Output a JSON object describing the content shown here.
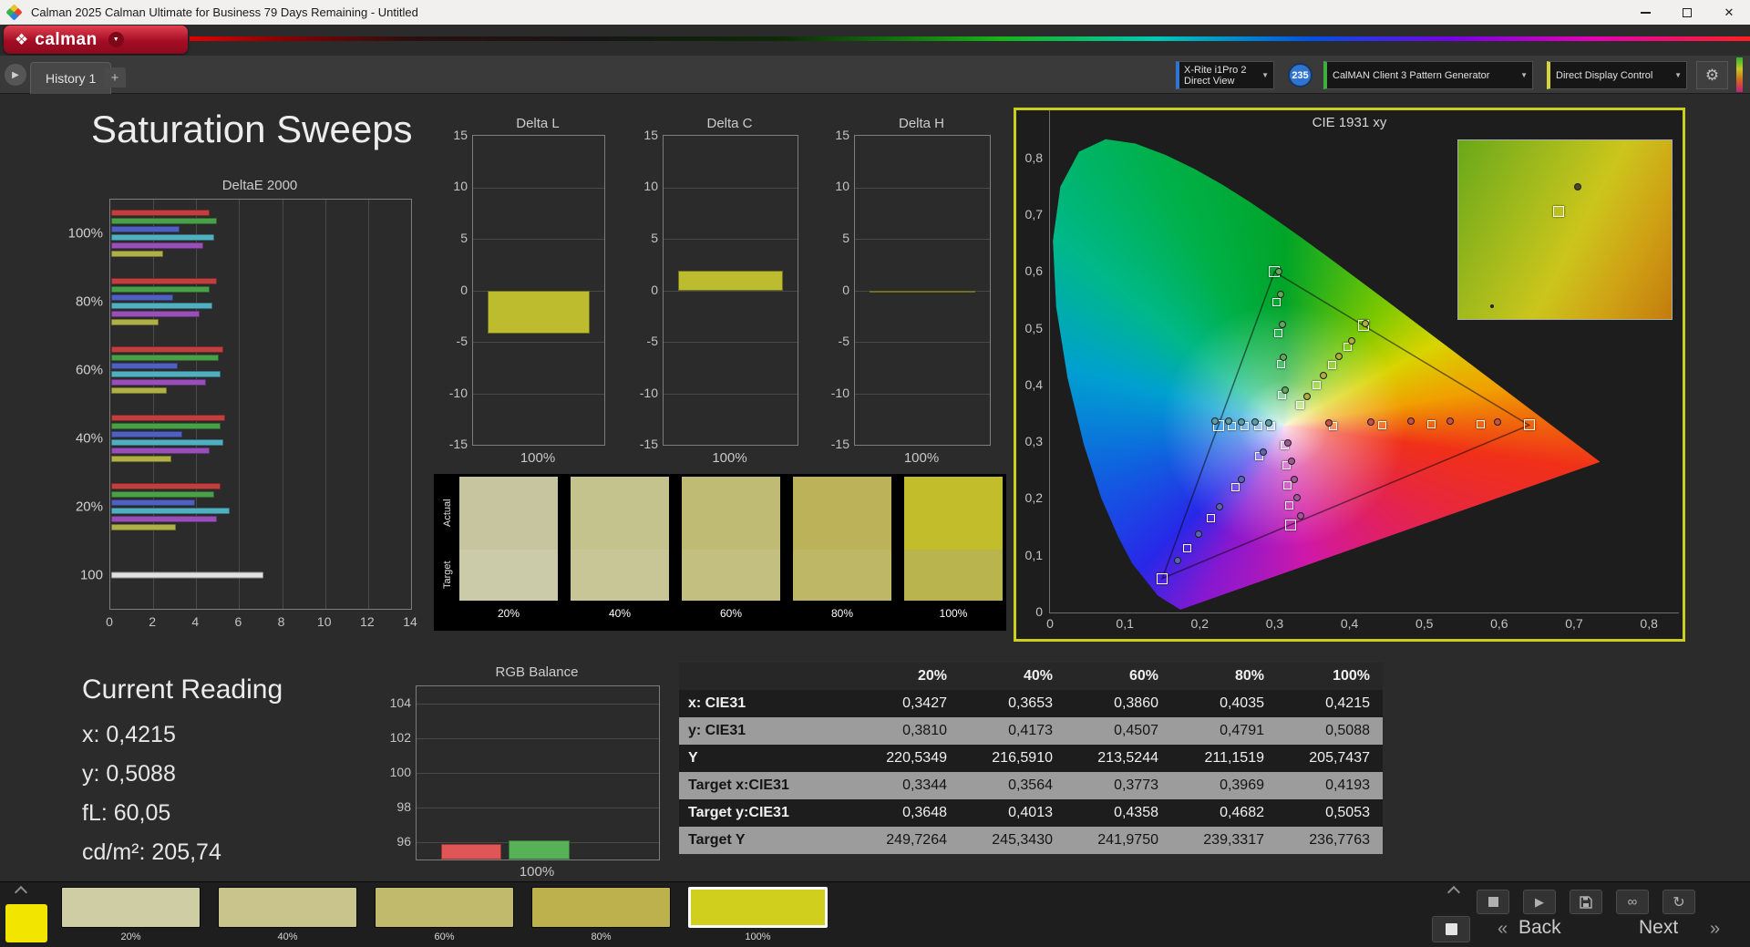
{
  "window": {
    "title": "Calman 2025 Calman Ultimate for Business 79 Days Remaining  - Untitled"
  },
  "brand": {
    "logo_text": "calman"
  },
  "tabs": {
    "history_label": "History 1",
    "add_label": "+"
  },
  "toolbar": {
    "meter_line1": "X-Rite i1Pro 2",
    "meter_line2": "Direct View",
    "badge": "235",
    "pattern_generator": "CalMAN Client 3 Pattern Generator",
    "display_control": "Direct Display Control"
  },
  "page": {
    "title": "Saturation Sweeps"
  },
  "current_reading": {
    "title": "Current Reading",
    "lines": [
      "x: 0,4215",
      "y: 0,5088",
      "fL: 60,05",
      "cd/m²: 205,74"
    ]
  },
  "swatch_panel": {
    "row_labels": [
      "Actual",
      "Target"
    ],
    "columns": [
      "20%",
      "40%",
      "60%",
      "80%",
      "100%"
    ],
    "actual_colors": [
      "#c6c5a0",
      "#c4c28d",
      "#bfba74",
      "#bbb25a",
      "#c2bd2a"
    ],
    "target_colors": [
      "#cbcaa9",
      "#c8c697",
      "#c3bf80",
      "#beb766",
      "#bab44e"
    ]
  },
  "table": {
    "columns": [
      "20%",
      "40%",
      "60%",
      "80%",
      "100%"
    ],
    "rows": [
      {
        "label": "x: CIE31",
        "shade": "dark",
        "values": [
          "0,3427",
          "0,3653",
          "0,3860",
          "0,4035",
          "0,4215"
        ]
      },
      {
        "label": "y: CIE31",
        "shade": "light",
        "values": [
          "0,3810",
          "0,4173",
          "0,4507",
          "0,4791",
          "0,5088"
        ]
      },
      {
        "label": "Y",
        "shade": "dark",
        "values": [
          "220,5349",
          "216,5910",
          "213,5244",
          "211,1519",
          "205,7437"
        ]
      },
      {
        "label": "Target x:CIE31",
        "shade": "light",
        "values": [
          "0,3344",
          "0,3564",
          "0,3773",
          "0,3969",
          "0,4193"
        ]
      },
      {
        "label": "Target y:CIE31",
        "shade": "dark",
        "values": [
          "0,3648",
          "0,4013",
          "0,4358",
          "0,4682",
          "0,5053"
        ]
      },
      {
        "label": "Target Y",
        "shade": "light",
        "values": [
          "249,7264",
          "245,3430",
          "241,9750",
          "239,3317",
          "236,7763"
        ]
      }
    ]
  },
  "bottom": {
    "preview_color": "#f2e500",
    "swatches": [
      {
        "label": "20%",
        "color": "#cfcda4",
        "selected": false
      },
      {
        "label": "40%",
        "color": "#c8c48c",
        "selected": false
      },
      {
        "label": "60%",
        "color": "#c1ba6c",
        "selected": false
      },
      {
        "label": "80%",
        "color": "#bcb14c",
        "selected": false
      },
      {
        "label": "100%",
        "color": "#d0cf1e",
        "selected": true
      }
    ],
    "back": "Back",
    "next": "Next",
    "back_arrow": "«",
    "next_arrow": "»"
  },
  "chart_data": [
    {
      "id": "deltae2000",
      "type": "bar",
      "orientation": "horizontal",
      "title": "DeltaE 2000",
      "xlim": [
        0,
        14
      ],
      "xticks": [
        0,
        2,
        4,
        6,
        8,
        10,
        12,
        14
      ],
      "palette": {
        "red": "#c04040",
        "green": "#49a049",
        "blue": "#5060c0",
        "cyan": "#50b0c0",
        "magenta": "#9850b8",
        "yellow": "#b0b048",
        "white": "#e2e2e2"
      },
      "groups": [
        {
          "label": "100%",
          "bars": [
            {
              "color": "red",
              "value": 4.6
            },
            {
              "color": "green",
              "value": 4.9
            },
            {
              "color": "blue",
              "value": 3.2
            },
            {
              "color": "cyan",
              "value": 4.8
            },
            {
              "color": "magenta",
              "value": 4.3
            },
            {
              "color": "yellow",
              "value": 2.4
            }
          ]
        },
        {
          "label": "80%",
          "bars": [
            {
              "color": "red",
              "value": 4.9
            },
            {
              "color": "green",
              "value": 4.6
            },
            {
              "color": "blue",
              "value": 2.9
            },
            {
              "color": "cyan",
              "value": 4.7
            },
            {
              "color": "magenta",
              "value": 4.1
            },
            {
              "color": "yellow",
              "value": 2.2
            }
          ]
        },
        {
          "label": "60%",
          "bars": [
            {
              "color": "red",
              "value": 5.2
            },
            {
              "color": "green",
              "value": 5.0
            },
            {
              "color": "blue",
              "value": 3.1
            },
            {
              "color": "cyan",
              "value": 5.1
            },
            {
              "color": "magenta",
              "value": 4.4
            },
            {
              "color": "yellow",
              "value": 2.6
            }
          ]
        },
        {
          "label": "40%",
          "bars": [
            {
              "color": "red",
              "value": 5.3
            },
            {
              "color": "green",
              "value": 5.1
            },
            {
              "color": "blue",
              "value": 3.3
            },
            {
              "color": "cyan",
              "value": 5.2
            },
            {
              "color": "magenta",
              "value": 4.6
            },
            {
              "color": "yellow",
              "value": 2.8
            }
          ]
        },
        {
          "label": "20%",
          "bars": [
            {
              "color": "red",
              "value": 5.1
            },
            {
              "color": "green",
              "value": 4.8
            },
            {
              "color": "blue",
              "value": 3.9
            },
            {
              "color": "cyan",
              "value": 5.5
            },
            {
              "color": "magenta",
              "value": 4.9
            },
            {
              "color": "yellow",
              "value": 3.0
            }
          ]
        },
        {
          "label": "100",
          "bars": [
            {
              "color": "white",
              "value": 7.1
            }
          ]
        }
      ]
    },
    {
      "id": "delta_l",
      "type": "bar",
      "title": "Delta L",
      "ylim": [
        -15,
        15
      ],
      "yticks": [
        15,
        10,
        5,
        0,
        -5,
        -10,
        -15
      ],
      "xlabel": "100%",
      "value": -4.2,
      "bar_color": "#bcbc2e"
    },
    {
      "id": "delta_c",
      "type": "bar",
      "title": "Delta C",
      "ylim": [
        -15,
        15
      ],
      "yticks": [
        15,
        10,
        5,
        0,
        -5,
        -10,
        -15
      ],
      "xlabel": "100%",
      "value": 1.9,
      "bar_color": "#bcbc2e"
    },
    {
      "id": "delta_h",
      "type": "bar",
      "title": "Delta H",
      "ylim": [
        -15,
        15
      ],
      "yticks": [
        15,
        10,
        5,
        0,
        -5,
        -10,
        -15
      ],
      "xlabel": "100%",
      "value": -0.15,
      "bar_color": "#bcbc2e"
    },
    {
      "id": "rgb_balance",
      "type": "bar",
      "title": "RGB Balance",
      "ylim": [
        95,
        105
      ],
      "yticks": [
        104,
        102,
        100,
        98,
        96
      ],
      "xlabel": "100%",
      "series": [
        {
          "name": "red",
          "value": 95.9,
          "color": "#e05555",
          "x": 0.1,
          "w": 0.25
        },
        {
          "name": "green",
          "value": 96.1,
          "color": "#57b257",
          "x": 0.38,
          "w": 0.25
        }
      ]
    },
    {
      "id": "cie1931",
      "type": "scatter",
      "title": "CIE 1931 xy",
      "xlim": [
        0,
        0.84
      ],
      "ylim": [
        0,
        0.8848
      ],
      "tick_values": [
        0,
        0.1,
        0.2,
        0.3,
        0.4,
        0.5,
        0.6,
        0.7,
        0.8
      ],
      "tick_labels": [
        "0",
        "0,1",
        "0,2",
        "0,3",
        "0,4",
        "0,5",
        "0,6",
        "0,7",
        "0,8"
      ],
      "white_point": [
        0.3127,
        0.329
      ],
      "srgb_triangle": [
        [
          0.64,
          0.33
        ],
        [
          0.3,
          0.6
        ],
        [
          0.15,
          0.06
        ]
      ],
      "locus": [
        [
          0.1741,
          0.005
        ],
        [
          0.144,
          0.0297
        ],
        [
          0.1096,
          0.0868
        ],
        [
          0.0913,
          0.1327
        ],
        [
          0.0687,
          0.2007
        ],
        [
          0.0454,
          0.295
        ],
        [
          0.0235,
          0.4127
        ],
        [
          0.0082,
          0.5384
        ],
        [
          0.0039,
          0.6548
        ],
        [
          0.0139,
          0.7502
        ],
        [
          0.0389,
          0.812
        ],
        [
          0.0743,
          0.8338
        ],
        [
          0.1142,
          0.8262
        ],
        [
          0.1547,
          0.8059
        ],
        [
          0.1929,
          0.7816
        ],
        [
          0.2296,
          0.7543
        ],
        [
          0.2658,
          0.7243
        ],
        [
          0.3016,
          0.6923
        ],
        [
          0.3373,
          0.6589
        ],
        [
          0.3731,
          0.6245
        ],
        [
          0.4087,
          0.5896
        ],
        [
          0.4441,
          0.5547
        ],
        [
          0.5125,
          0.4866
        ],
        [
          0.5752,
          0.4242
        ],
        [
          0.627,
          0.3725
        ],
        [
          0.6658,
          0.334
        ],
        [
          0.6915,
          0.3083
        ],
        [
          0.7347,
          0.2653
        ]
      ],
      "sweeps": [
        {
          "name": "red",
          "color": "#c85048",
          "targets": [
            [
              0.378,
              0.329
            ],
            [
              0.444,
              0.33
            ],
            [
              0.509,
              0.331
            ],
            [
              0.575,
              0.331
            ],
            [
              0.64,
              0.33
            ]
          ],
          "measured": [
            [
              0.372,
              0.334
            ],
            [
              0.428,
              0.336
            ],
            [
              0.482,
              0.338
            ],
            [
              0.535,
              0.338
            ],
            [
              0.598,
              0.336
            ]
          ]
        },
        {
          "name": "green",
          "color": "#60a858",
          "targets": [
            [
              0.31,
              0.383
            ],
            [
              0.308,
              0.437
            ],
            [
              0.305,
              0.492
            ],
            [
              0.303,
              0.546
            ],
            [
              0.3,
              0.6
            ]
          ],
          "measured": [
            [
              0.314,
              0.392
            ],
            [
              0.312,
              0.45
            ],
            [
              0.31,
              0.507
            ],
            [
              0.308,
              0.56
            ],
            [
              0.306,
              0.601
            ]
          ]
        },
        {
          "name": "blue",
          "color": "#5868b0",
          "targets": [
            [
              0.28,
              0.275
            ],
            [
              0.248,
              0.221
            ],
            [
              0.215,
              0.167
            ],
            [
              0.183,
              0.113
            ],
            [
              0.15,
              0.06
            ]
          ],
          "measured": [
            [
              0.285,
              0.283
            ],
            [
              0.256,
              0.234
            ],
            [
              0.227,
              0.186
            ],
            [
              0.198,
              0.138
            ],
            [
              0.17,
              0.092
            ]
          ]
        },
        {
          "name": "cyan",
          "color": "#58a0a8",
          "targets": [
            [
              0.295,
              0.329
            ],
            [
              0.278,
              0.329
            ],
            [
              0.26,
              0.329
            ],
            [
              0.243,
              0.329
            ],
            [
              0.225,
              0.329
            ]
          ],
          "measured": [
            [
              0.292,
              0.334
            ],
            [
              0.274,
              0.335
            ],
            [
              0.256,
              0.336
            ],
            [
              0.238,
              0.337
            ],
            [
              0.22,
              0.338
            ]
          ]
        },
        {
          "name": "magenta",
          "color": "#a05898",
          "targets": [
            [
              0.314,
              0.294
            ],
            [
              0.316,
              0.259
            ],
            [
              0.317,
              0.224
            ],
            [
              0.319,
              0.189
            ],
            [
              0.321,
              0.154
            ]
          ],
          "measured": [
            [
              0.318,
              0.298
            ],
            [
              0.322,
              0.266
            ],
            [
              0.326,
              0.234
            ],
            [
              0.33,
              0.202
            ],
            [
              0.335,
              0.17
            ]
          ]
        },
        {
          "name": "yellow",
          "color": "#b0ac3c",
          "targets": [
            [
              0.3344,
              0.3648
            ],
            [
              0.3564,
              0.4013
            ],
            [
              0.3773,
              0.4358
            ],
            [
              0.3969,
              0.4682
            ],
            [
              0.4193,
              0.5053
            ]
          ],
          "measured": [
            [
              0.3427,
              0.381
            ],
            [
              0.3653,
              0.4173
            ],
            [
              0.386,
              0.4507
            ],
            [
              0.4035,
              0.4791
            ],
            [
              0.4215,
              0.5088
            ]
          ]
        }
      ],
      "inset": {
        "square": [
          0.47,
          0.4
        ],
        "dot": [
          0.56,
          0.26
        ],
        "speck": [
          0.15,
          0.92
        ]
      }
    }
  ]
}
